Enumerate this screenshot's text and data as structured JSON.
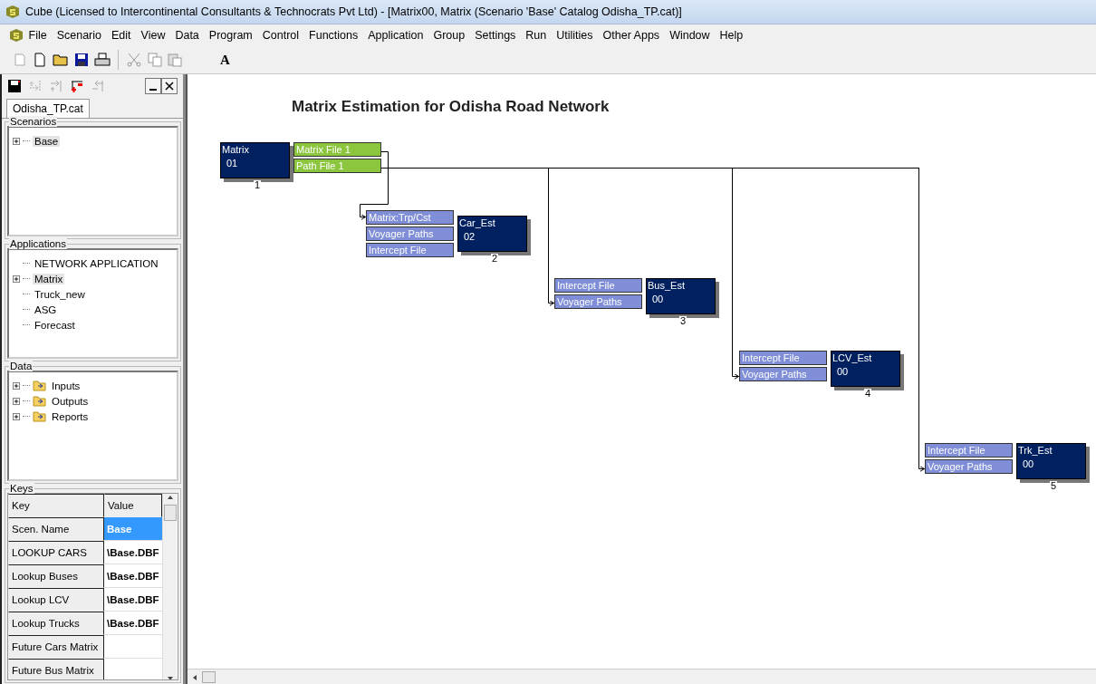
{
  "window": {
    "title": "Cube (Licensed to Intercontinental Consultants & Technocrats Pvt Ltd) - [Matrix00, Matrix (Scenario 'Base' Catalog Odisha_TP.cat)]"
  },
  "menu": [
    "File",
    "Scenario",
    "Edit",
    "View",
    "Data",
    "Program",
    "Control",
    "Functions",
    "Application",
    "Group",
    "Settings",
    "Run",
    "Utilities",
    "Other Apps",
    "Window",
    "Help"
  ],
  "toolbar": {
    "font_button": "A"
  },
  "catalog": {
    "tab": "Odisha_TP.cat",
    "scenarios": {
      "title": "Scenarios",
      "items": [
        {
          "label": "Base",
          "expandable": true,
          "selected": true
        }
      ]
    },
    "applications": {
      "title": "Applications",
      "items": [
        {
          "label": "NETWORK APPLICATION",
          "expandable": false,
          "selected": false
        },
        {
          "label": "Matrix",
          "expandable": true,
          "selected": true
        },
        {
          "label": "Truck_new",
          "expandable": false,
          "selected": false
        },
        {
          "label": "ASG",
          "expandable": false,
          "selected": false
        },
        {
          "label": "Forecast",
          "expandable": false,
          "selected": false
        }
      ]
    },
    "data": {
      "title": "Data",
      "items": [
        {
          "label": "Inputs",
          "expandable": true,
          "selected": false
        },
        {
          "label": "Outputs",
          "expandable": true,
          "selected": false
        },
        {
          "label": "Reports",
          "expandable": true,
          "selected": false
        }
      ]
    },
    "keys": {
      "title": "Keys",
      "columns": [
        "Key",
        "Value"
      ],
      "rows": [
        {
          "key": "Scen. Name",
          "value": "Base",
          "selected": true
        },
        {
          "key": "LOOKUP CARS",
          "value": "\\Base.DBF",
          "selected": false
        },
        {
          "key": "Lookup Buses",
          "value": "\\Base.DBF",
          "selected": false
        },
        {
          "key": "Lookup LCV",
          "value": "\\Base.DBF",
          "selected": false
        },
        {
          "key": "Lookup Trucks",
          "value": "\\Base.DBF",
          "selected": false
        },
        {
          "key": "Future Cars Matrix",
          "selected": false
        },
        {
          "key": "Future Bus Matrix",
          "selected": false
        }
      ]
    }
  },
  "diagram": {
    "title": "Matrix Estimation for Odisha Road Network",
    "nodes": [
      {
        "name": "Matrix",
        "code": "01",
        "number": "1",
        "outputs": [
          "Matrix File 1",
          "Path File 1"
        ]
      },
      {
        "name": "Car_Est",
        "code": "02",
        "number": "2",
        "inputs": [
          "Matrix:Trp/Cst",
          "Voyager Paths",
          "Intercept File"
        ]
      },
      {
        "name": "Bus_Est",
        "code": "00",
        "number": "3",
        "inputs": [
          "Intercept File",
          "Voyager Paths"
        ]
      },
      {
        "name": "LCV_Est",
        "code": "00",
        "number": "4",
        "inputs": [
          "Intercept File",
          "Voyager Paths"
        ]
      },
      {
        "name": "Trk_Est",
        "code": "00",
        "number": "5",
        "inputs": [
          "Intercept File",
          "Voyager Paths"
        ]
      }
    ]
  }
}
